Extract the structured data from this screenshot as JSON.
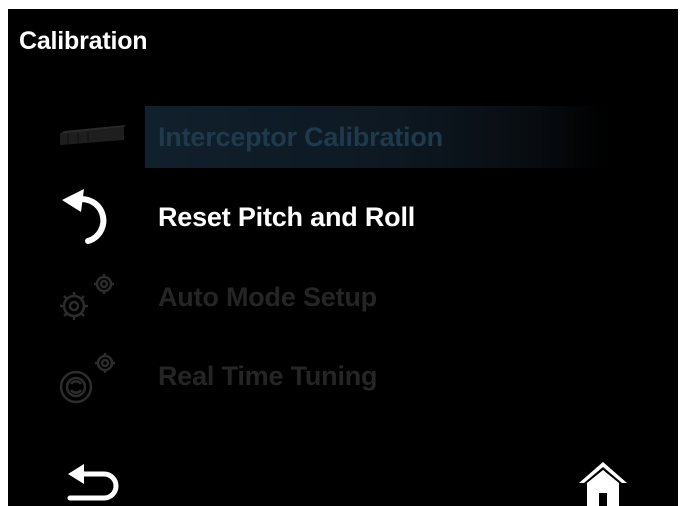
{
  "header": {
    "title": "Calibration"
  },
  "menu": {
    "items": [
      {
        "label": "Interceptor Calibration",
        "icon": "interceptor-icon",
        "state": "highlighted"
      },
      {
        "label": "Reset Pitch and Roll",
        "icon": "reset-arrow-icon",
        "state": "enabled"
      },
      {
        "label": "Auto Mode Setup",
        "icon": "gears-icon",
        "state": "disabled"
      },
      {
        "label": "Real Time Tuning",
        "icon": "tuning-gear-icon",
        "state": "disabled"
      }
    ]
  },
  "footer": {
    "back_icon": "back-arrow-icon",
    "home_icon": "home-icon"
  },
  "colors": {
    "background": "#000000",
    "text_enabled": "#ffffff",
    "text_disabled": "#252525",
    "highlight": "#10202c"
  }
}
